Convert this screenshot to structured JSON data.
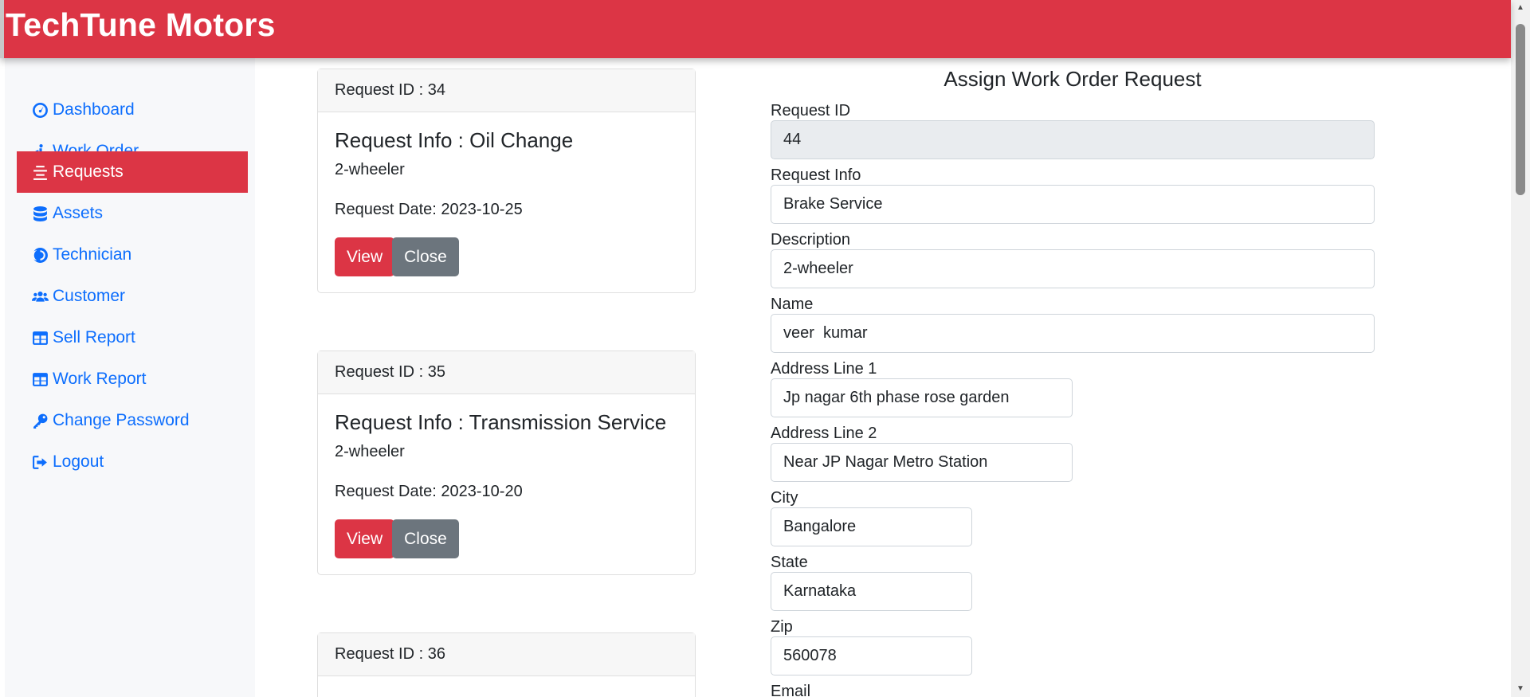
{
  "brand": "TechTune Motors",
  "sidebar": {
    "items": [
      {
        "label": "Dashboard",
        "icon": "gauge-icon"
      },
      {
        "label": "Work Order",
        "icon": "accessibility-icon"
      },
      {
        "label": "Requests",
        "icon": "align-center-icon",
        "active": true
      },
      {
        "label": "Assets",
        "icon": "database-icon"
      },
      {
        "label": "Technician",
        "icon": "technician-icon"
      },
      {
        "label": "Customer",
        "icon": "users-icon"
      },
      {
        "label": "Sell Report",
        "icon": "table-icon"
      },
      {
        "label": "Work Report",
        "icon": "table-icon"
      },
      {
        "label": "Change Password",
        "icon": "key-icon"
      },
      {
        "label": "Logout",
        "icon": "logout-icon"
      }
    ]
  },
  "requests": [
    {
      "header": "Request ID : 34",
      "title": "Request Info : Oil Change",
      "desc": "2-wheeler",
      "date": "Request Date: 2023-10-25",
      "view": "View",
      "close": "Close"
    },
    {
      "header": "Request ID : 35",
      "title": "Request Info : Transmission Service",
      "desc": "2-wheeler",
      "date": "Request Date: 2023-10-20",
      "view": "View",
      "close": "Close"
    },
    {
      "header": "Request ID : 36"
    }
  ],
  "form": {
    "title": "Assign Work Order Request",
    "fields": [
      {
        "label": "Request ID",
        "value": "44"
      },
      {
        "label": "Request Info",
        "value": "Brake Service"
      },
      {
        "label": "Description",
        "value": "2-wheeler"
      },
      {
        "label": "Name",
        "value": "veer  kumar"
      },
      {
        "label": "Address Line 1",
        "value": "Jp nagar 6th phase rose garden"
      },
      {
        "label": "Address Line 2",
        "value": "Near JP Nagar Metro Station"
      },
      {
        "label": "City",
        "value": "Bangalore"
      },
      {
        "label": "State",
        "value": "Karnataka"
      },
      {
        "label": "Zip",
        "value": "560078"
      },
      {
        "label": "Email",
        "value": ""
      }
    ]
  },
  "colors": {
    "accent": "#dc3545",
    "link": "#0d6efd",
    "secondary": "#6c757d"
  }
}
